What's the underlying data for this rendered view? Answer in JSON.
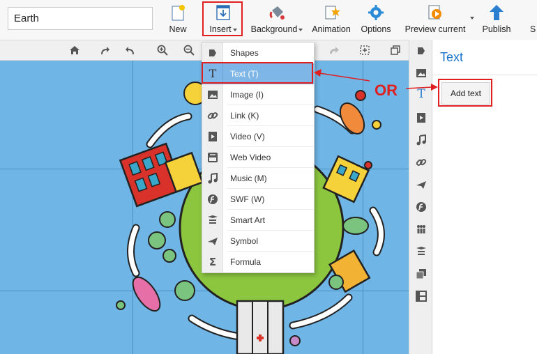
{
  "title_input": {
    "value": "Earth"
  },
  "toolbar": {
    "new_label": "New",
    "insert_label": "Insert",
    "background_label": "Background",
    "animation_label": "Animation",
    "options_label": "Options",
    "preview_label": "Preview current",
    "publish_label": "Publish",
    "cut_label": "S"
  },
  "insert_menu": {
    "items": [
      {
        "label": "Shapes",
        "icon": "shapes-icon"
      },
      {
        "label": "Text (T)",
        "icon": "text-icon"
      },
      {
        "label": "Image (I)",
        "icon": "image-icon"
      },
      {
        "label": "Link (K)",
        "icon": "link-icon"
      },
      {
        "label": "Video (V)",
        "icon": "video-icon"
      },
      {
        "label": "Web Video",
        "icon": "youtube-icon"
      },
      {
        "label": "Music (M)",
        "icon": "music-icon"
      },
      {
        "label": "SWF (W)",
        "icon": "swf-icon"
      },
      {
        "label": "Smart Art",
        "icon": "smart-art-icon"
      },
      {
        "label": "Symbol",
        "icon": "symbol-icon"
      },
      {
        "label": "Formula",
        "icon": "formula-icon"
      }
    ],
    "selected_index": 1
  },
  "right_panel": {
    "title": "Text",
    "add_text_label": "Add text"
  },
  "annotation": {
    "or_label": "OR"
  },
  "colors": {
    "canvas_bg": "#6fb5e6",
    "accent_blue": "#1a73c8",
    "highlight_red": "#e02020",
    "menu_selected": "#7fb6e8",
    "planet_green": "#8cc63f"
  }
}
